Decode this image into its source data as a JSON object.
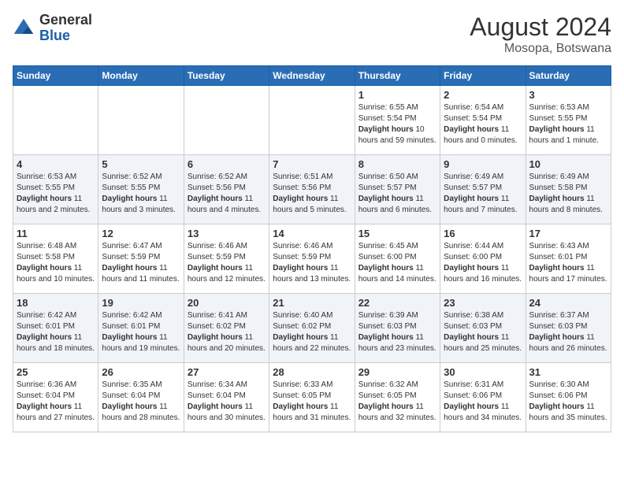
{
  "header": {
    "logo_general": "General",
    "logo_blue": "Blue",
    "month_year": "August 2024",
    "location": "Mosopa, Botswana"
  },
  "days_of_week": [
    "Sunday",
    "Monday",
    "Tuesday",
    "Wednesday",
    "Thursday",
    "Friday",
    "Saturday"
  ],
  "weeks": [
    [
      {
        "day": "",
        "info": ""
      },
      {
        "day": "",
        "info": ""
      },
      {
        "day": "",
        "info": ""
      },
      {
        "day": "",
        "info": ""
      },
      {
        "day": "1",
        "info": "Sunrise: 6:55 AM\nSunset: 5:54 PM\nDaylight: 10 hours and 59 minutes."
      },
      {
        "day": "2",
        "info": "Sunrise: 6:54 AM\nSunset: 5:54 PM\nDaylight: 11 hours and 0 minutes."
      },
      {
        "day": "3",
        "info": "Sunrise: 6:53 AM\nSunset: 5:55 PM\nDaylight: 11 hours and 1 minute."
      }
    ],
    [
      {
        "day": "4",
        "info": "Sunrise: 6:53 AM\nSunset: 5:55 PM\nDaylight: 11 hours and 2 minutes."
      },
      {
        "day": "5",
        "info": "Sunrise: 6:52 AM\nSunset: 5:55 PM\nDaylight: 11 hours and 3 minutes."
      },
      {
        "day": "6",
        "info": "Sunrise: 6:52 AM\nSunset: 5:56 PM\nDaylight: 11 hours and 4 minutes."
      },
      {
        "day": "7",
        "info": "Sunrise: 6:51 AM\nSunset: 5:56 PM\nDaylight: 11 hours and 5 minutes."
      },
      {
        "day": "8",
        "info": "Sunrise: 6:50 AM\nSunset: 5:57 PM\nDaylight: 11 hours and 6 minutes."
      },
      {
        "day": "9",
        "info": "Sunrise: 6:49 AM\nSunset: 5:57 PM\nDaylight: 11 hours and 7 minutes."
      },
      {
        "day": "10",
        "info": "Sunrise: 6:49 AM\nSunset: 5:58 PM\nDaylight: 11 hours and 8 minutes."
      }
    ],
    [
      {
        "day": "11",
        "info": "Sunrise: 6:48 AM\nSunset: 5:58 PM\nDaylight: 11 hours and 10 minutes."
      },
      {
        "day": "12",
        "info": "Sunrise: 6:47 AM\nSunset: 5:59 PM\nDaylight: 11 hours and 11 minutes."
      },
      {
        "day": "13",
        "info": "Sunrise: 6:46 AM\nSunset: 5:59 PM\nDaylight: 11 hours and 12 minutes."
      },
      {
        "day": "14",
        "info": "Sunrise: 6:46 AM\nSunset: 5:59 PM\nDaylight: 11 hours and 13 minutes."
      },
      {
        "day": "15",
        "info": "Sunrise: 6:45 AM\nSunset: 6:00 PM\nDaylight: 11 hours and 14 minutes."
      },
      {
        "day": "16",
        "info": "Sunrise: 6:44 AM\nSunset: 6:00 PM\nDaylight: 11 hours and 16 minutes."
      },
      {
        "day": "17",
        "info": "Sunrise: 6:43 AM\nSunset: 6:01 PM\nDaylight: 11 hours and 17 minutes."
      }
    ],
    [
      {
        "day": "18",
        "info": "Sunrise: 6:42 AM\nSunset: 6:01 PM\nDaylight: 11 hours and 18 minutes."
      },
      {
        "day": "19",
        "info": "Sunrise: 6:42 AM\nSunset: 6:01 PM\nDaylight: 11 hours and 19 minutes."
      },
      {
        "day": "20",
        "info": "Sunrise: 6:41 AM\nSunset: 6:02 PM\nDaylight: 11 hours and 20 minutes."
      },
      {
        "day": "21",
        "info": "Sunrise: 6:40 AM\nSunset: 6:02 PM\nDaylight: 11 hours and 22 minutes."
      },
      {
        "day": "22",
        "info": "Sunrise: 6:39 AM\nSunset: 6:03 PM\nDaylight: 11 hours and 23 minutes."
      },
      {
        "day": "23",
        "info": "Sunrise: 6:38 AM\nSunset: 6:03 PM\nDaylight: 11 hours and 25 minutes."
      },
      {
        "day": "24",
        "info": "Sunrise: 6:37 AM\nSunset: 6:03 PM\nDaylight: 11 hours and 26 minutes."
      }
    ],
    [
      {
        "day": "25",
        "info": "Sunrise: 6:36 AM\nSunset: 6:04 PM\nDaylight: 11 hours and 27 minutes."
      },
      {
        "day": "26",
        "info": "Sunrise: 6:35 AM\nSunset: 6:04 PM\nDaylight: 11 hours and 28 minutes."
      },
      {
        "day": "27",
        "info": "Sunrise: 6:34 AM\nSunset: 6:04 PM\nDaylight: 11 hours and 30 minutes."
      },
      {
        "day": "28",
        "info": "Sunrise: 6:33 AM\nSunset: 6:05 PM\nDaylight: 11 hours and 31 minutes."
      },
      {
        "day": "29",
        "info": "Sunrise: 6:32 AM\nSunset: 6:05 PM\nDaylight: 11 hours and 32 minutes."
      },
      {
        "day": "30",
        "info": "Sunrise: 6:31 AM\nSunset: 6:06 PM\nDaylight: 11 hours and 34 minutes."
      },
      {
        "day": "31",
        "info": "Sunrise: 6:30 AM\nSunset: 6:06 PM\nDaylight: 11 hours and 35 minutes."
      }
    ]
  ]
}
